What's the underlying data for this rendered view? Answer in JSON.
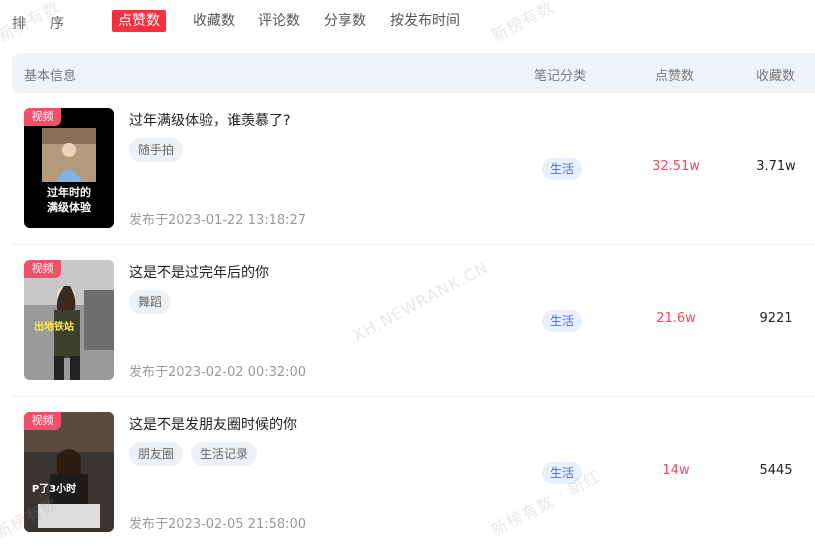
{
  "sort": {
    "label_1": "排",
    "label_2": "序",
    "options": [
      "点赞数",
      "收藏数",
      "评论数",
      "分享数",
      "按发布时间"
    ]
  },
  "table": {
    "headers": {
      "info": "基本信息",
      "category": "笔记分类",
      "likes": "点赞数",
      "favorites": "收藏数"
    },
    "rows": [
      {
        "badge": "视频",
        "title": "过年满级体验，谁羡慕了?",
        "tags": [
          "随手拍"
        ],
        "published": "发布于2023-01-22 13:18:27",
        "category": "生活",
        "likes": "32.51w",
        "favorites": "3.71w",
        "thumb_caption": "过年时的\n满级体验"
      },
      {
        "badge": "视频",
        "title": "这是不是过完年后的你",
        "tags": [
          "舞蹈"
        ],
        "published": "发布于2023-02-02 00:32:00",
        "category": "生活",
        "likes": "21.6w",
        "favorites": "9221",
        "thumb_caption": "出地铁站"
      },
      {
        "badge": "视频",
        "title": "这是不是发朋友圈时候的你",
        "tags": [
          "朋友圈",
          "生活记录"
        ],
        "published": "发布于2023-02-05 21:58:00",
        "category": "生活",
        "likes": "14w",
        "favorites": "5445",
        "thumb_caption": "P了3小时"
      }
    ]
  },
  "watermarks": [
    "新榜有数",
    "新榜有数",
    "XH.NEWRANK.CN",
    "新榜有数 · 新红",
    "新榜有数"
  ],
  "colors": {
    "accent": "#f5303f",
    "likes": "#f04a5a",
    "category_bg": "#e9effc",
    "category_text": "#4a6fd8"
  }
}
